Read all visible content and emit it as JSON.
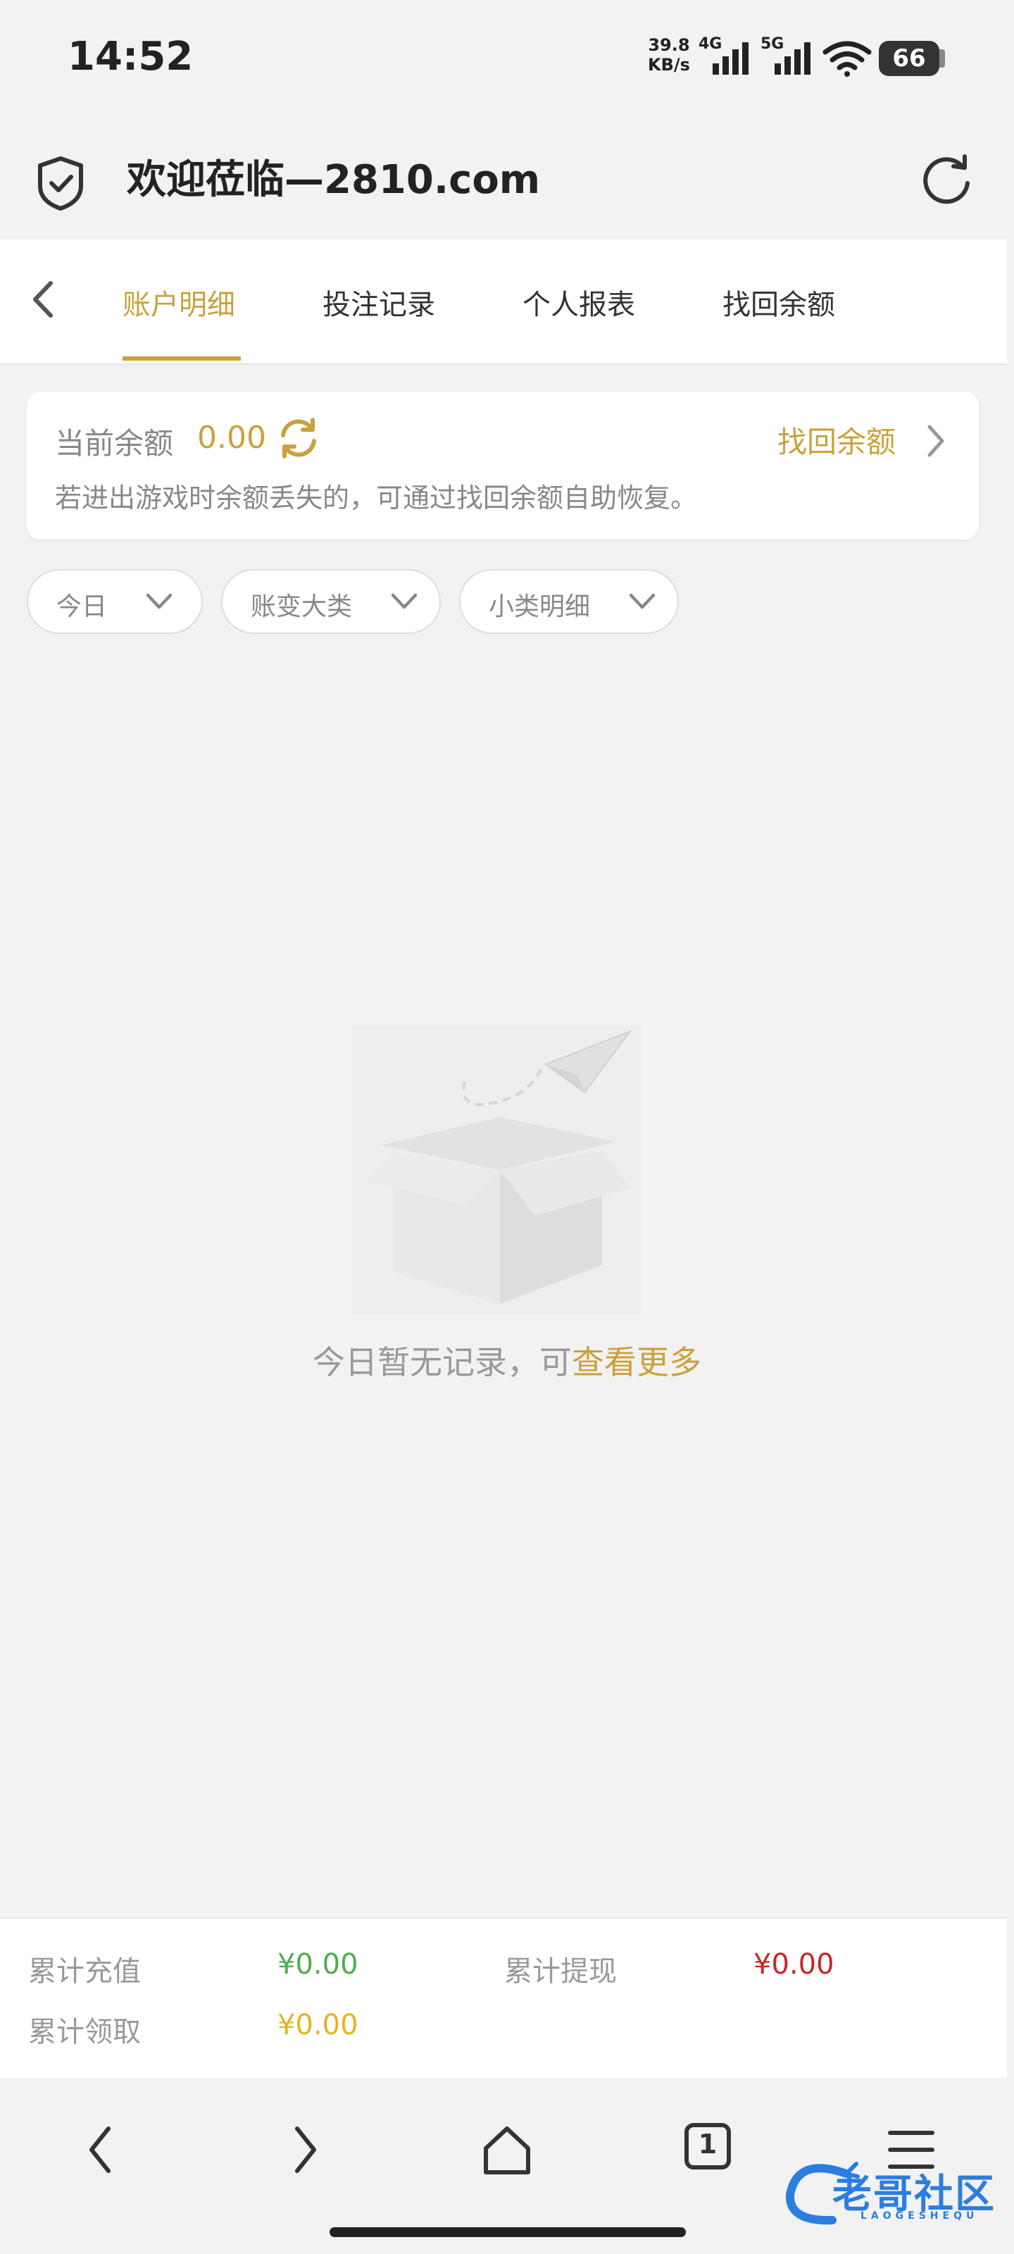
{
  "status_bar": {
    "time": "14:52",
    "net_speed_value": "39.8",
    "net_speed_unit": "KB/s",
    "signal1_label": "4G",
    "signal2_label": "5G",
    "battery": "66"
  },
  "browser": {
    "title": "欢迎莅临—2810.com"
  },
  "tabs": [
    {
      "label": "账户明细",
      "active": true
    },
    {
      "label": "投注记录",
      "active": false
    },
    {
      "label": "个人报表",
      "active": false
    },
    {
      "label": "找回余额",
      "active": false
    }
  ],
  "balance": {
    "label": "当前余额",
    "value": "0.00",
    "recover_link": "找回余额",
    "hint": "若进出游戏时余额丢失的，可通过找回余额自助恢复。"
  },
  "filters": [
    {
      "label": "今日"
    },
    {
      "label": "账变大类"
    },
    {
      "label": "小类明细"
    }
  ],
  "empty_state": {
    "text": "今日暂无记录，可",
    "link": "查看更多"
  },
  "summary": {
    "recharge_label": "累计充值",
    "recharge_value": "¥0.00",
    "withdraw_label": "累计提现",
    "withdraw_value": "¥0.00",
    "claim_label": "累计领取",
    "claim_value": "¥0.00"
  },
  "nav": {
    "tab_count": "1"
  },
  "watermark": {
    "text": "老哥社区",
    "subtext": "LAOGESHEQU"
  },
  "colors": {
    "accent": "#c9a23b",
    "recharge": "#4caf50",
    "withdraw": "#c62828",
    "claim": "#e6b422"
  }
}
